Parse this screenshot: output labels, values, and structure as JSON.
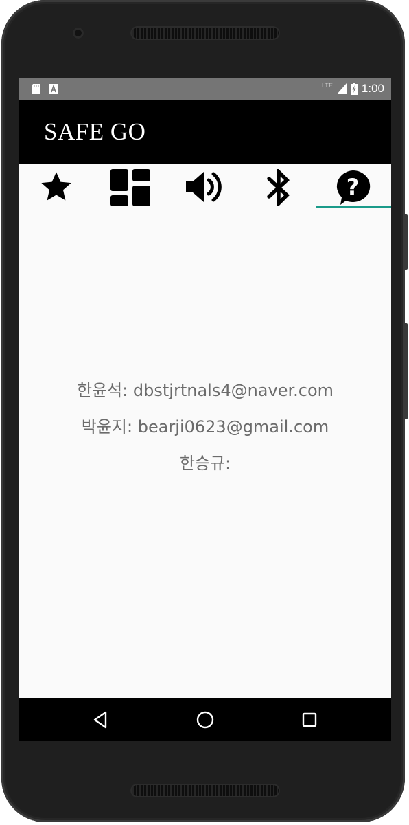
{
  "status_bar": {
    "left_icons": [
      "sd-card-icon",
      "text-notification-icon"
    ],
    "network": "LTE",
    "time": "1:00"
  },
  "app": {
    "title": "SAFE GO"
  },
  "tabs": [
    {
      "icon": "star-icon",
      "active": false
    },
    {
      "icon": "dashboard-icon",
      "active": false
    },
    {
      "icon": "volume-icon",
      "active": false
    },
    {
      "icon": "bluetooth-icon",
      "active": false
    },
    {
      "icon": "help-icon",
      "active": true
    }
  ],
  "contacts": [
    {
      "text": "한윤석: dbstjrtnals4@naver.com"
    },
    {
      "text": "박윤지: bearji0623@gmail.com"
    },
    {
      "text": "한승규:"
    }
  ],
  "nav_bar": {
    "buttons": [
      "back-icon",
      "home-icon",
      "recents-icon"
    ]
  },
  "colors": {
    "toolbar": "#000000",
    "status_bar": "#757575",
    "tab_indicator": "#1a9b8a",
    "content_text": "#6b6b6b"
  }
}
